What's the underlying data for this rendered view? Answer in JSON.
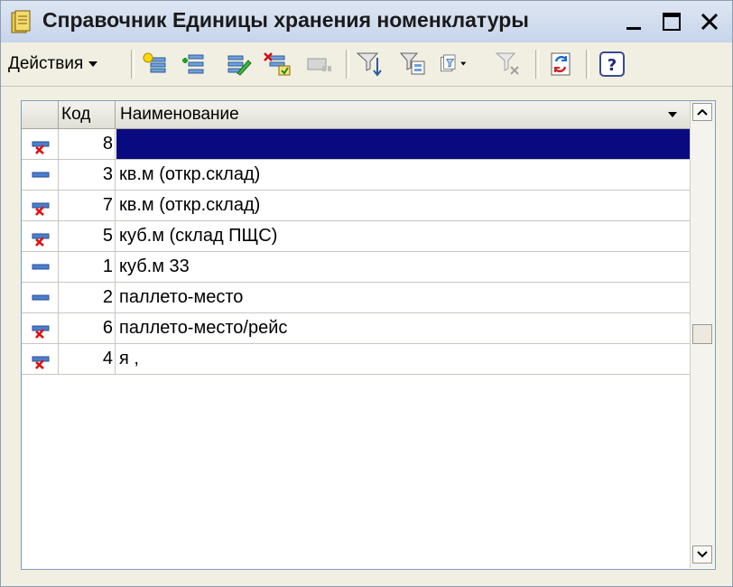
{
  "window": {
    "title": "Справочник Единицы хранения номенклатуры"
  },
  "toolbar": {
    "actions_label": "Действия",
    "buttons": [
      {
        "icon": "add-icon"
      },
      {
        "icon": "add-group-icon"
      },
      {
        "icon": "edit-icon"
      },
      {
        "icon": "delete-mark-icon"
      },
      {
        "icon": "copy-disabled-icon"
      },
      {
        "icon": "sort-icon"
      },
      {
        "icon": "filter-icon"
      },
      {
        "icon": "filter-list-icon"
      },
      {
        "icon": "filter-clear-icon"
      },
      {
        "icon": "refresh-icon"
      },
      {
        "icon": "help-icon"
      }
    ]
  },
  "grid": {
    "columns": {
      "code": "Код",
      "name": "Наименование"
    },
    "rows": [
      {
        "code": "8",
        "name": "",
        "marked": true,
        "selected": true
      },
      {
        "code": "3",
        "name": "кв.м (откр.склад)",
        "marked": false
      },
      {
        "code": "7",
        "name": "кв.м (откр.склад)",
        "marked": true
      },
      {
        "code": "5",
        "name": "куб.м (склад ПЩС)",
        "marked": true
      },
      {
        "code": "1",
        "name": "куб.м 33",
        "marked": false
      },
      {
        "code": "2",
        "name": "паллето-место",
        "marked": false
      },
      {
        "code": "6",
        "name": "паллето-место/рейс",
        "marked": true
      },
      {
        "code": "4",
        "name": "я ,",
        "marked": true
      }
    ]
  }
}
